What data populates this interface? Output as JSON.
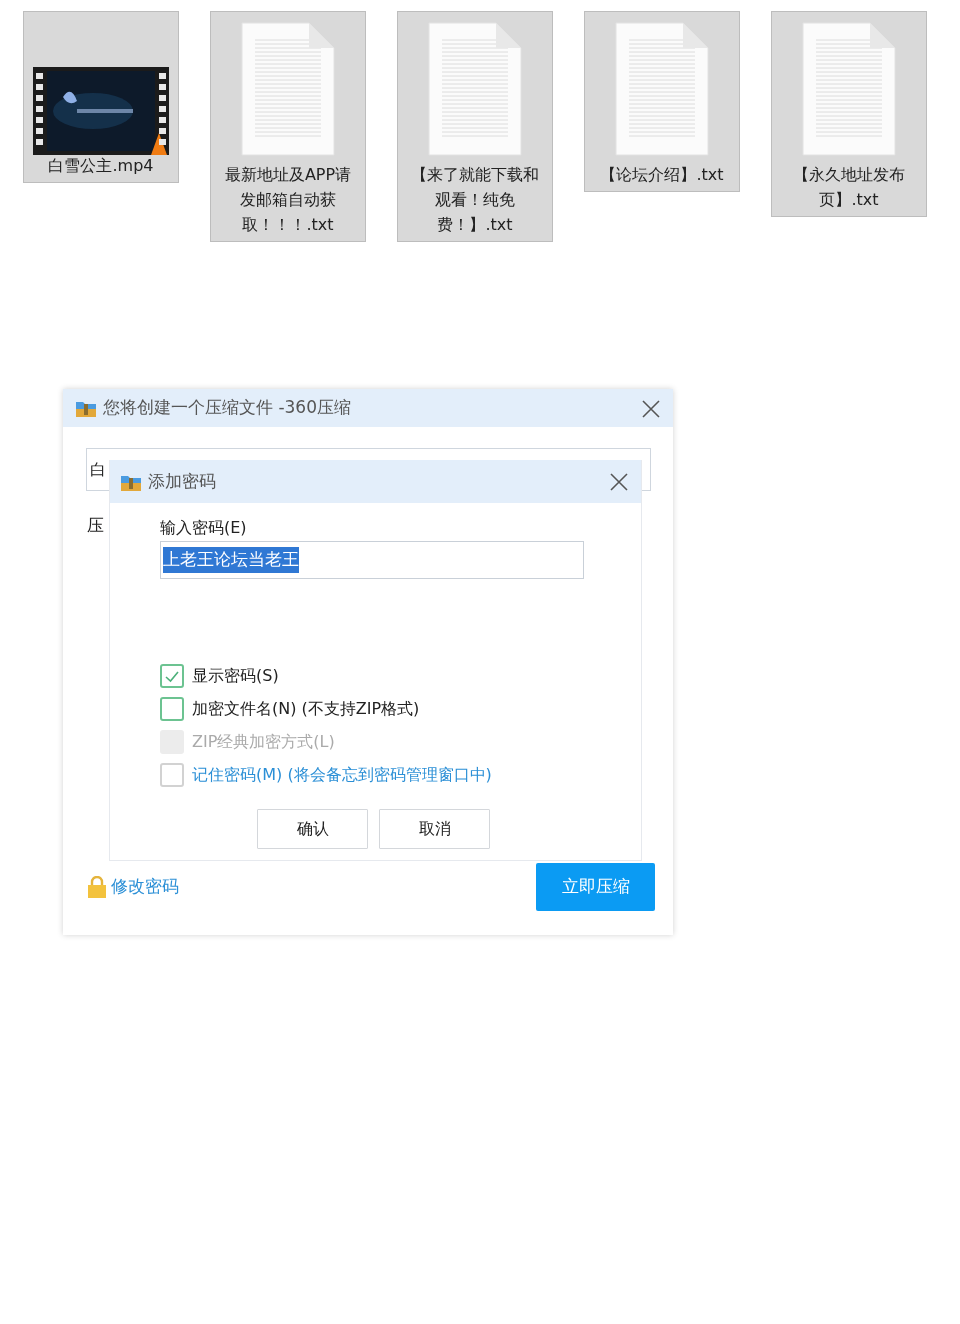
{
  "files": [
    {
      "kind": "video",
      "name": "白雪公主.mp4"
    },
    {
      "kind": "text",
      "name": "最新地址及APP请发邮箱自动获取！！！.txt"
    },
    {
      "kind": "text",
      "name": "【来了就能下载和观看！纯免费！】.txt"
    },
    {
      "kind": "text",
      "name": "【论坛介绍】.txt"
    },
    {
      "kind": "text",
      "name": "【永久地址发布页】.txt"
    }
  ],
  "compress_dialog": {
    "title": "您将创建一个压缩文件 -360压缩",
    "path_value": "白",
    "label": "压",
    "change_password_link": "修改密码",
    "compress_button": "立即压缩"
  },
  "password_dialog": {
    "title": "添加密码",
    "password_label": "输入密码(E)",
    "password": {
      "value": "上老王论坛当老王",
      "selected": true
    },
    "options": [
      {
        "label": "显示密码(S)",
        "checked": true,
        "disabled": false,
        "kind": "plain"
      },
      {
        "label": "加密文件名(N) (不支持ZIP格式)",
        "checked": false,
        "disabled": false,
        "kind": "plain"
      },
      {
        "label": "ZIP经典加密方式(L)",
        "checked": false,
        "disabled": true,
        "kind": "plain"
      },
      {
        "label": "记住密码(M) (将会备忘到密码管理窗口中)",
        "checked": false,
        "disabled": false,
        "kind": "link"
      }
    ],
    "buttons": [
      "确认",
      "取消"
    ]
  }
}
